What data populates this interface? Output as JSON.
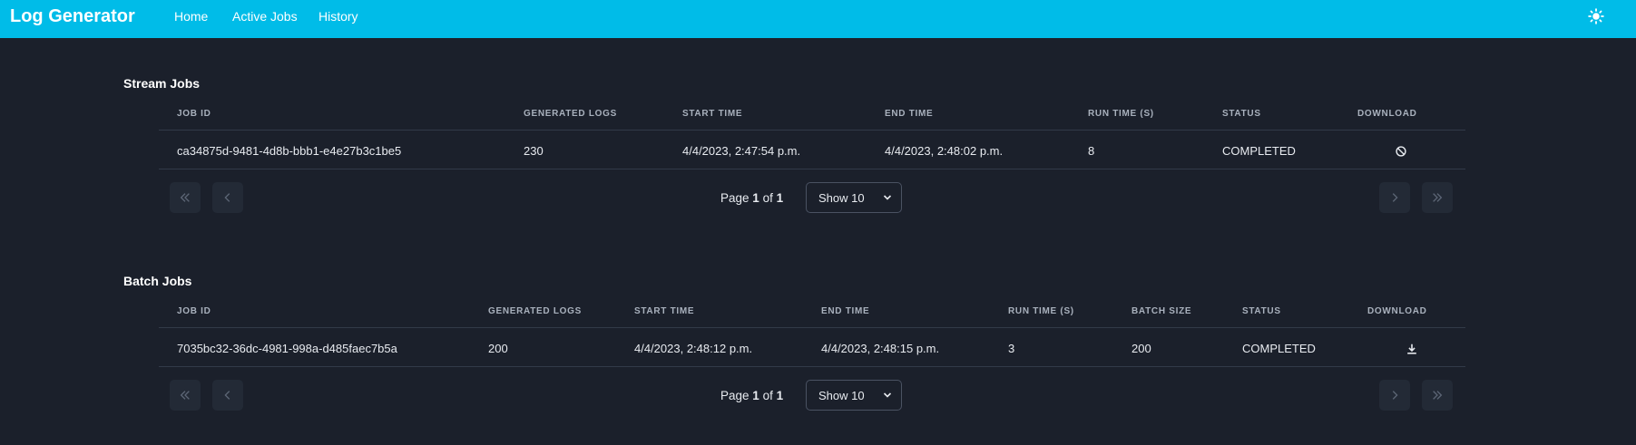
{
  "app": {
    "title": "Log Generator",
    "nav": [
      {
        "label": "Home"
      },
      {
        "label": "Active Jobs"
      },
      {
        "label": "History"
      }
    ],
    "theme_icon": "sun-icon"
  },
  "stream": {
    "title": "Stream Jobs",
    "columns": [
      "JOB ID",
      "GENERATED LOGS",
      "START TIME",
      "END TIME",
      "RUN TIME (S)",
      "STATUS",
      "DOWNLOAD"
    ],
    "rows": [
      {
        "job_id": "ca34875d-9481-4d8b-bbb1-e4e27b3c1be5",
        "generated_logs": "230",
        "start_time": "4/4/2023, 2:47:54 p.m.",
        "end_time": "4/4/2023, 2:48:02 p.m.",
        "run_time": "8",
        "status": "COMPLETED",
        "download_icon": "ban-icon"
      }
    ],
    "pager": {
      "page_prefix": "Page",
      "page": "1",
      "of": "of",
      "total": "1",
      "show_label": "Show 10"
    }
  },
  "batch": {
    "title": "Batch Jobs",
    "columns": [
      "JOB ID",
      "GENERATED LOGS",
      "START TIME",
      "END TIME",
      "RUN TIME (S)",
      "BATCH SIZE",
      "STATUS",
      "DOWNLOAD"
    ],
    "rows": [
      {
        "job_id": "7035bc32-36dc-4981-998a-d485faec7b5a",
        "generated_logs": "200",
        "start_time": "4/4/2023, 2:48:12 p.m.",
        "end_time": "4/4/2023, 2:48:15 p.m.",
        "run_time": "3",
        "batch_size": "200",
        "status": "COMPLETED",
        "download_icon": "download-icon"
      }
    ],
    "pager": {
      "page_prefix": "Page",
      "page": "1",
      "of": "of",
      "total": "1",
      "show_label": "Show 10"
    }
  },
  "colors": {
    "topbar": "#00bce8",
    "background": "#1b202b",
    "pager_button": "#232a36"
  }
}
